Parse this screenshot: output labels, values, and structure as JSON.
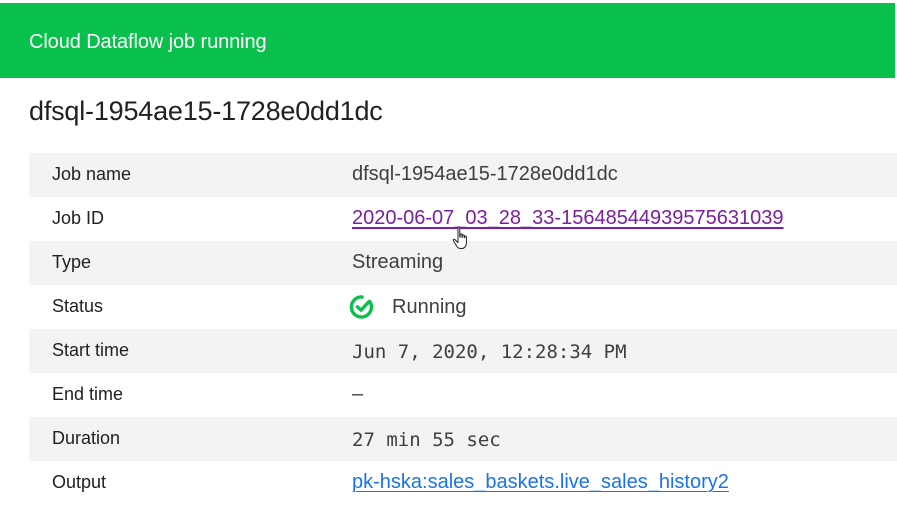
{
  "banner": {
    "title": "Cloud Dataflow job running",
    "color": "#0ac04d"
  },
  "job": {
    "heading": "dfsql-1954ae15-1728e0dd1dc"
  },
  "details": [
    {
      "label": "Job name",
      "value": "dfsql-1954ae15-1728e0dd1dc"
    },
    {
      "label": "Job ID",
      "value": "2020-06-07_03_28_33-15648544939575631039"
    },
    {
      "label": "Type",
      "value": "Streaming"
    },
    {
      "label": "Status",
      "value": "Running",
      "icon": "running-check-icon",
      "status_color": "#0ac04d"
    },
    {
      "label": "Start time",
      "value": "Jun 7, 2020, 12:28:34 PM"
    },
    {
      "label": "End time",
      "value": "–"
    },
    {
      "label": "Duration",
      "value": "27 min 55 sec"
    },
    {
      "label": "Output",
      "value": "pk-hska:sales_baskets.live_sales_history2"
    }
  ],
  "colors": {
    "visited_link": "#7b1fa2",
    "link": "#1a73e8",
    "row_shade": "#f3f3f3"
  },
  "cursor_icon": "hand-pointer-icon"
}
